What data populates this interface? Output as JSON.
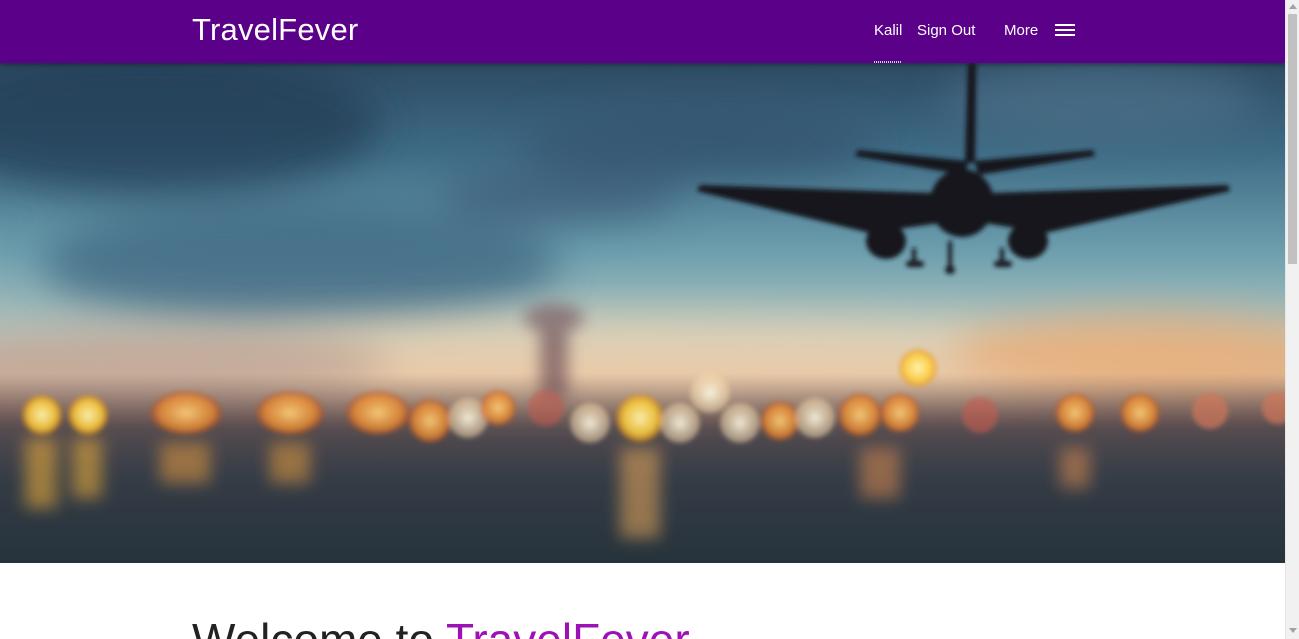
{
  "navbar": {
    "brand": "TravelFever",
    "user_link": "Kalil",
    "signout_link": "Sign Out",
    "more_link": "More",
    "menu_icon": "hamburger-menu-icon",
    "background_color": "#5b0088"
  },
  "hero": {
    "image_subject": "airplane-landing-bokeh-sunset"
  },
  "welcome": {
    "prefix": "Welcome to ",
    "brand": "TravelFever",
    "accent_color": "#9b12b5"
  }
}
